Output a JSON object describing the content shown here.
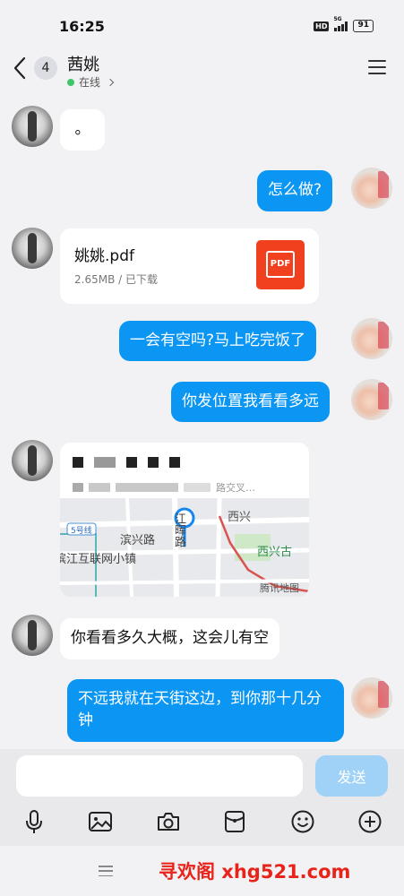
{
  "status_bar": {
    "time": "16:25",
    "hd": "HD",
    "network": "5G",
    "battery": "91"
  },
  "header": {
    "back_count": "4",
    "contact_name": "茜姚",
    "status_text": "在线"
  },
  "messages": [
    {
      "side": "in",
      "type": "text",
      "text": "。"
    },
    {
      "side": "out",
      "type": "text",
      "text": "怎么做?"
    },
    {
      "side": "in",
      "type": "file",
      "file_name": "姚姚.pdf",
      "file_meta": "2.65MB / 已下载",
      "file_icon_label": "PDF"
    },
    {
      "side": "out",
      "type": "text",
      "text": "一会有空吗?马上吃完饭了"
    },
    {
      "side": "out",
      "type": "text",
      "text": "你发位置我看看多远"
    },
    {
      "side": "in",
      "type": "location",
      "address_suffix": "路交叉…",
      "map_labels": {
        "line": "5号线",
        "road1": "滨兴路",
        "road2": "江晖路",
        "area": "西兴",
        "poi": "西兴古",
        "town": "滨江互联网小镇",
        "brand": "腾讯地图"
      }
    },
    {
      "side": "in",
      "type": "text",
      "text": "你看看多久大概，这会儿有空"
    },
    {
      "side": "out",
      "type": "text",
      "text": "不远我就在天街这边，到你那十几分钟"
    }
  ],
  "input": {
    "placeholder": "",
    "value": "",
    "send_label": "发送"
  },
  "toolbar": [
    "mic-icon",
    "image-icon",
    "camera-icon",
    "red-packet-icon",
    "emoji-icon",
    "plus-icon"
  ],
  "watermark": "寻欢阁 xhg521.com"
}
